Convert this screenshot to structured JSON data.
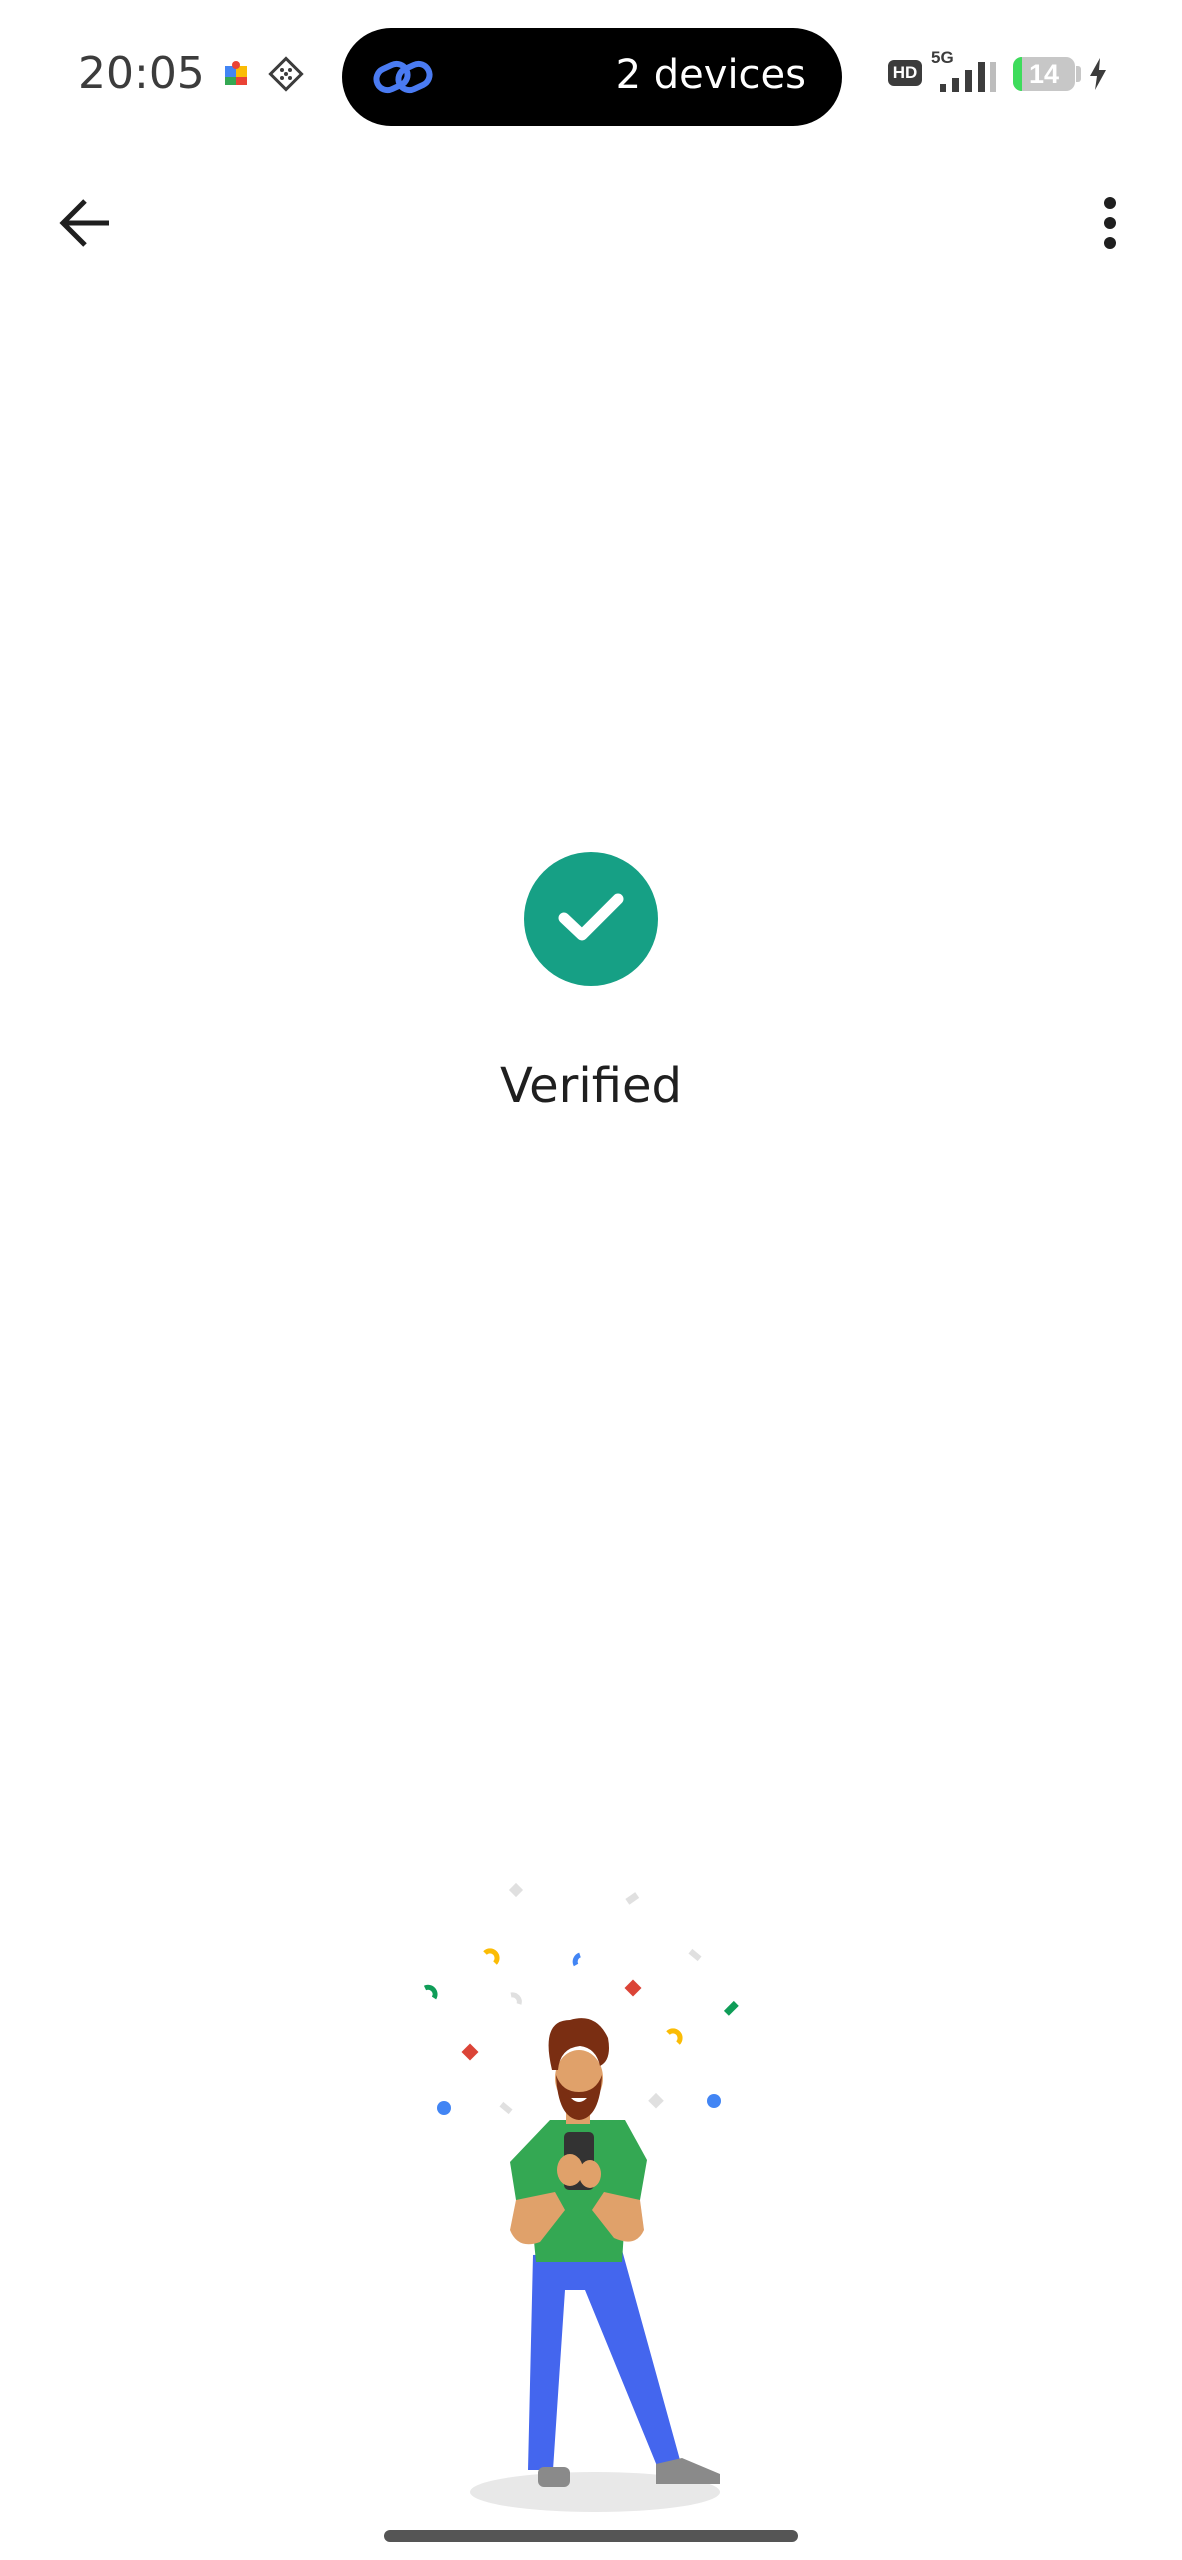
{
  "status_bar": {
    "time": "20:05",
    "pill_label": "2 devices",
    "hd_badge": "HD",
    "network": "5G",
    "battery_level": "14",
    "battery_fraction": 0.14,
    "icons": [
      "puzzle-app-icon",
      "grid-app-icon",
      "link-icon",
      "signal-icon",
      "battery-icon",
      "charging-icon"
    ]
  },
  "app_bar": {
    "back_icon": "arrow-left-icon",
    "menu_icon": "more-vert-icon"
  },
  "main": {
    "status_icon": "check-icon",
    "status_color": "#16a085",
    "status_label": "Verified"
  },
  "illustration": {
    "name": "person-holding-phone-illustration",
    "colors": {
      "shirt": "#34a853",
      "pants": "#4466ee",
      "skin": "#e0a16a",
      "hair": "#7a2e12"
    }
  }
}
